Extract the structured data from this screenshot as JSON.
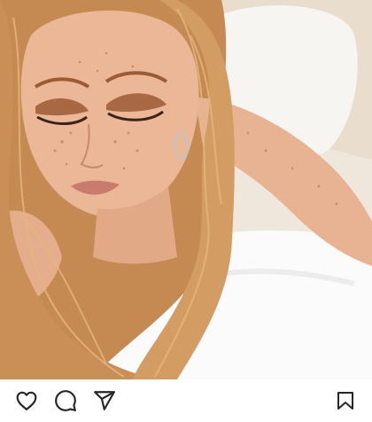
{
  "post": {
    "photo": {
      "icon": "portrait-photo",
      "palette": {
        "background": "#efe8df",
        "pillow": "#f6f4f1",
        "sheet": "#ffffff",
        "hair": "#c98f57",
        "hair_light": "#e2b07a",
        "skin": "#e9b493",
        "eyeshadow": "#9a5a33",
        "lips": "#c77a6e"
      }
    },
    "actions": {
      "like_icon": "heart-icon",
      "comment_icon": "comment-icon",
      "share_icon": "paper-plane-icon",
      "save_icon": "bookmark-icon",
      "icon_color": "#262626"
    }
  }
}
